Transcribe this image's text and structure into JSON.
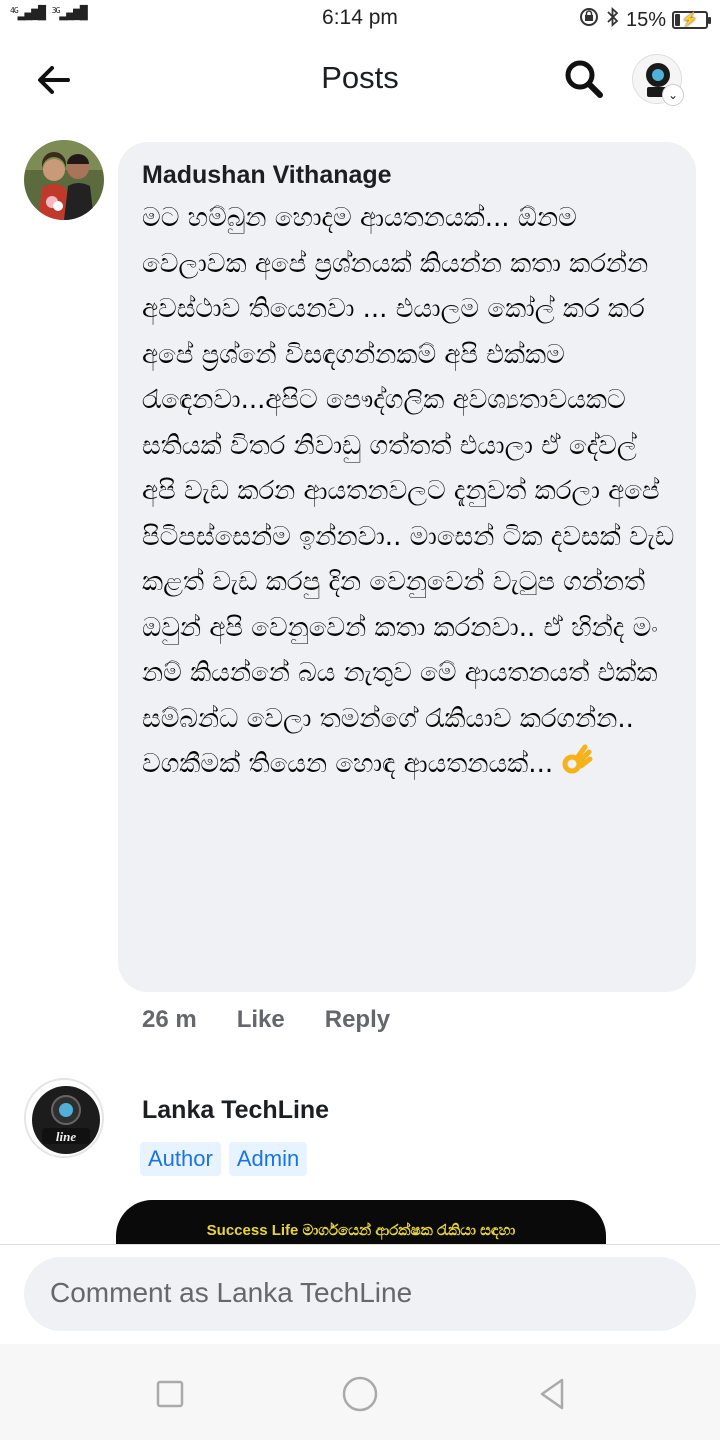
{
  "status_bar": {
    "network": "4G",
    "network2": "3G",
    "time": "6:14 pm",
    "battery": "15%",
    "battery_level": 0.15
  },
  "header": {
    "title": "Posts"
  },
  "comment1": {
    "author": "Madushan Vithanage",
    "text": "මට හම්බුන හොදම ආයතනයක්... ඕනම වෙලාවක අපේ ප්‍රශ්නයක් කියන්න කතා කරන්න අවස්ථාව තියෙනවා ... එයාලම කෝල් කර කර අපේ ප්‍රශ්නේ විසඳගන්නකම් අපි එක්කම රැඳෙනවා...අපිට පෞද්ගලික අවශ්‍යතාවයකට සතියක් විතර නිවාඩු ගත්තත් එයාලා ඒ දේවල් අපි වැඩ කරන ආයතනවලට දැනුවත් කරලා අපේ පිටිපස්සෙන්ම ඉන්නවා.. මාසෙන් ටික දවසක් වැඩ කළත් වැඩ කරපු දින වෙනුවෙන් වැටුප ගන්නත් ඔවුන් අපි වෙනුවෙන් කතා කරනවා.. ඒ හින්ද මං නම් කියන්නේ බය නැතුව මේ ආයතනයත් එක්ක සම්බන්ධ වෙලා තමන්ගේ රැකියාව කරගන්න.. වගකීමක් තියෙන හොඳ ආයතනයක්...",
    "time": "26 m",
    "like": "Like",
    "reply": "Reply"
  },
  "comment2": {
    "author": "Lanka TechLine",
    "badges": [
      "Author",
      "Admin"
    ],
    "logo_text": "line",
    "banner_text": "Success Life මාර්ගයෙන් ආරක්ෂක රැකියා සඳහා"
  },
  "composer": {
    "placeholder": "Comment as Lanka TechLine"
  },
  "colors": {
    "bubble": "#eff1f5",
    "badge_bg": "#e7f3ff",
    "badge_text": "#1b74e4",
    "meta": "#65676b"
  }
}
